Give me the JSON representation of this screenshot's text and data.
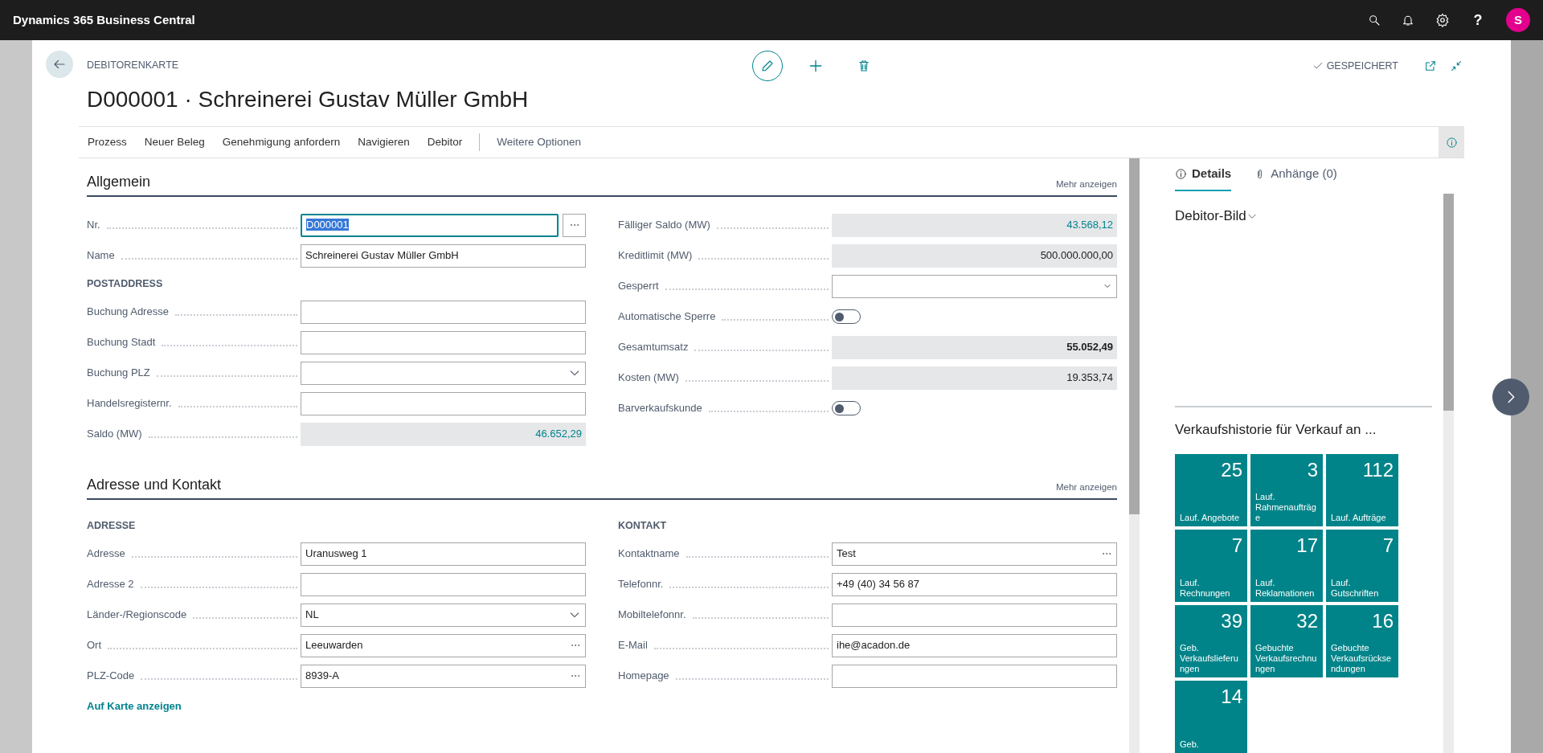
{
  "app_bar": {
    "title": "Dynamics 365 Business Central",
    "help": "?",
    "avatar": "S"
  },
  "page": {
    "caption": "DEBITORENKARTE",
    "title": "D000001 · Schreinerei Gustav Müller GmbH",
    "save_status": "GESPEICHERT"
  },
  "actions": [
    "Prozess",
    "Neuer Beleg",
    "Genehmigung anfordern",
    "Navigieren",
    "Debitor"
  ],
  "more_options": "Weitere Optionen",
  "sections": [
    {
      "title": "Allgemein",
      "show_more": "Mehr anzeigen",
      "columns": [
        [
          {
            "kind": "assist",
            "label": "Nr.",
            "value": "D000001",
            "focused": true
          },
          {
            "kind": "text",
            "label": "Name",
            "value": "Schreinerei Gustav Müller GmbH",
            "focused": false
          },
          {
            "kind": "heading",
            "label": "POSTADDRESS"
          },
          {
            "kind": "text",
            "label": "Buchung Adresse",
            "focused": false
          },
          {
            "kind": "text",
            "label": "Buchung Stadt",
            "focused": false
          },
          {
            "kind": "combo",
            "label": "Buchung PLZ",
            "focused": false
          },
          {
            "kind": "text",
            "label": "Handelsregisternr.",
            "focused": false
          },
          {
            "kind": "readonly",
            "label": "Saldo (MW)",
            "value": "46.652,29",
            "link": true,
            "bold": false
          }
        ],
        [
          {
            "kind": "readonly",
            "label": "Fälliger Saldo (MW)",
            "value": "43.568,12",
            "link": true,
            "bold": false
          },
          {
            "kind": "readonly",
            "label": "Kreditlimit (MW)",
            "value": "500.000.000,00",
            "link": false,
            "bold": false
          },
          {
            "kind": "select",
            "label": "Gesperrt",
            "focused": false
          },
          {
            "kind": "toggle",
            "label": "Automatische Sperre",
            "on": false
          },
          {
            "kind": "readonly",
            "label": "Gesamtumsatz",
            "value": "55.052,49",
            "link": false,
            "bold": true
          },
          {
            "kind": "readonly",
            "label": "Kosten (MW)",
            "value": "19.353,74",
            "link": false,
            "bold": false
          },
          {
            "kind": "toggle",
            "label": "Barverkaufskunde",
            "on": false
          }
        ]
      ]
    },
    {
      "title": "Adresse und Kontakt",
      "show_more": "Mehr anzeigen",
      "columns": [
        [
          {
            "kind": "heading",
            "label": "ADRESSE"
          },
          {
            "kind": "text",
            "label": "Adresse",
            "value": "Uranusweg 1",
            "focused": false
          },
          {
            "kind": "text",
            "label": "Adresse 2",
            "focused": false
          },
          {
            "kind": "combo",
            "label": "Länder-/Regionscode",
            "value": "NL",
            "focused": false
          },
          {
            "kind": "lookup",
            "label": "Ort",
            "value": "Leeuwarden",
            "focused": false
          },
          {
            "kind": "lookup",
            "label": "PLZ-Code",
            "value": "8939-A",
            "focused": false
          },
          {
            "kind": "link",
            "label": "Auf Karte anzeigen"
          }
        ],
        [
          {
            "kind": "heading",
            "label": "KONTAKT"
          },
          {
            "kind": "lookup",
            "label": "Kontaktname",
            "value": "Test",
            "focused": false
          },
          {
            "kind": "text",
            "label": "Telefonnr.",
            "value": "+49 (40) 34 56 87",
            "focused": false
          },
          {
            "kind": "text",
            "label": "Mobiltelefonnr.",
            "focused": false
          },
          {
            "kind": "text",
            "label": "E-Mail",
            "value": "ihe@acadon.de",
            "focused": false
          },
          {
            "kind": "text",
            "label": "Homepage",
            "focused": false
          }
        ]
      ]
    }
  ],
  "factbox": {
    "tabs": [
      {
        "label": "Details",
        "selected": true
      },
      {
        "label": "Anhänge (0)",
        "selected": false
      }
    ],
    "picture_title": "Debitor-Bild",
    "history_title": "Verkaufshistorie für Verkauf an ...",
    "tiles": [
      {
        "count": "25",
        "caption": "Lauf. Angebote"
      },
      {
        "count": "3",
        "caption": "Lauf. Rahmenaufträge"
      },
      {
        "count": "112",
        "caption": "Lauf. Aufträge"
      },
      {
        "count": "7",
        "caption": "Lauf. Rechnungen"
      },
      {
        "count": "17",
        "caption": "Lauf. Reklamationen"
      },
      {
        "count": "7",
        "caption": "Lauf. Gutschriften"
      },
      {
        "count": "39",
        "caption": "Geb. Verkaufslieferungen"
      },
      {
        "count": "32",
        "caption": "Gebuchte Verkaufsrechnungen"
      },
      {
        "count": "16",
        "caption": "Gebuchte Verkaufsrücksendungen"
      },
      {
        "count": "14",
        "caption": "Geb."
      }
    ]
  }
}
